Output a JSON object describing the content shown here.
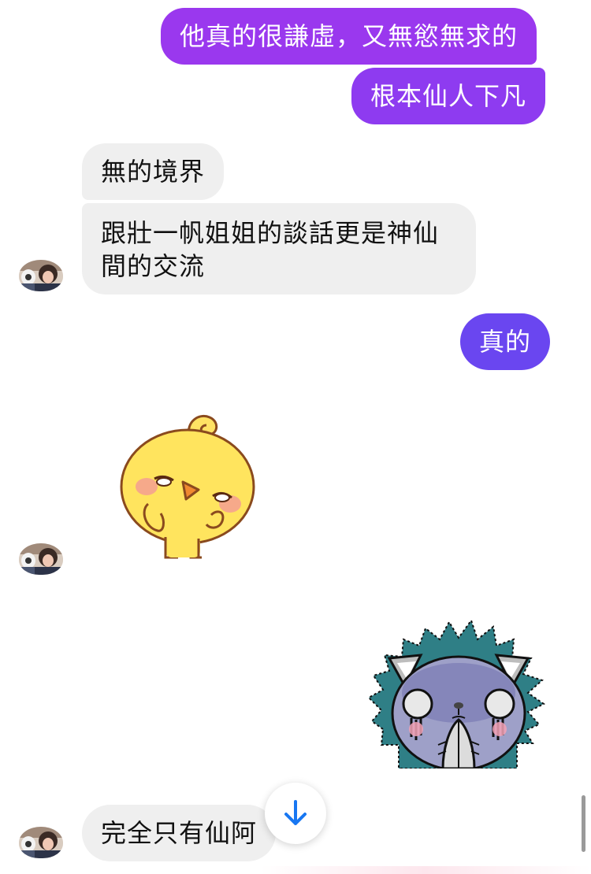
{
  "colors": {
    "outgoing_purple": "#9a38ee",
    "outgoing_indigo": "#6a46f0",
    "incoming_bubble": "#efefef",
    "scroll_arrow": "#1877f2"
  },
  "messages": [
    {
      "side": "outgoing",
      "text": "他真的很謙虛，又無慾無求的"
    },
    {
      "side": "outgoing",
      "text": "根本仙人下凡"
    },
    {
      "side": "incoming",
      "text": "無的境界"
    },
    {
      "side": "incoming",
      "text": "跟壯一帆姐姐的談話更是神仙間的交流"
    },
    {
      "side": "outgoing",
      "text": "真的"
    },
    {
      "side": "incoming",
      "type": "sticker",
      "sticker": "yellow-chick-sticker"
    },
    {
      "side": "outgoing",
      "type": "sticker",
      "sticker": "crying-cat-sticker"
    },
    {
      "side": "incoming",
      "text": "完全只有仙阿"
    }
  ],
  "icons": {
    "scroll_down": "arrow-down-icon"
  }
}
